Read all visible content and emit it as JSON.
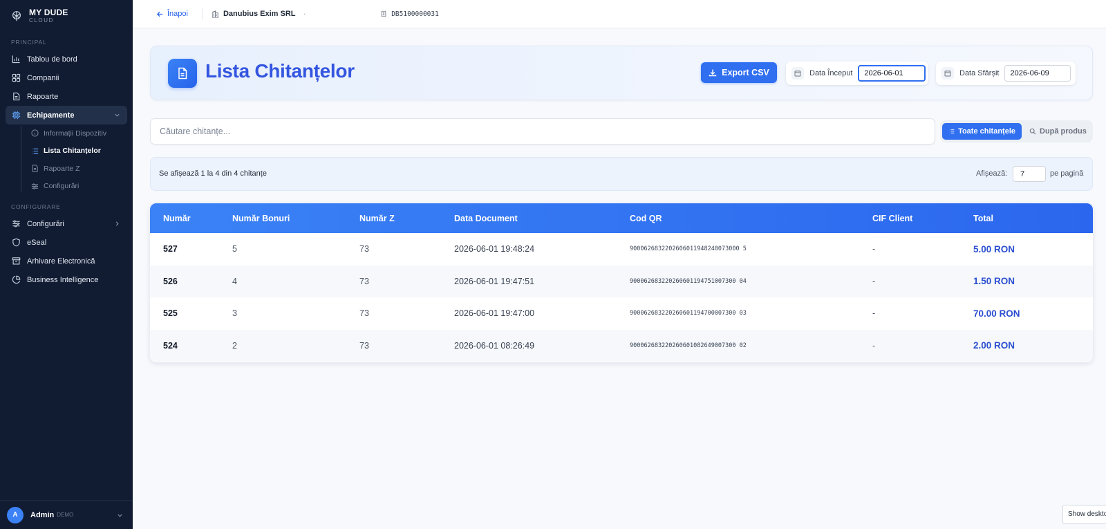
{
  "brand": {
    "title": "MY DUDE",
    "subtitle": "CLOUD"
  },
  "sidebar": {
    "sections": {
      "principal": "PRINCIPAL",
      "configurare": "CONFIGURARE"
    },
    "principal_items": [
      {
        "label": "Tablou de bord",
        "icon": "bar-chart-icon"
      },
      {
        "label": "Companii",
        "icon": "grid-icon"
      },
      {
        "label": "Rapoarte",
        "icon": "document-icon"
      },
      {
        "label": "Echipamente",
        "icon": "chip-icon",
        "active": true
      }
    ],
    "echipamente_sub": [
      {
        "label": "Informații Dispozitiv",
        "icon": "info-icon"
      },
      {
        "label": "Lista Chitanțelor",
        "icon": "list-icon",
        "active": true
      },
      {
        "label": "Rapoarte Z",
        "icon": "document-icon"
      },
      {
        "label": "Configurări",
        "icon": "sliders-icon"
      }
    ],
    "configurare_items": [
      {
        "label": "Configurări",
        "icon": "sliders-icon"
      },
      {
        "label": "eSeal",
        "icon": "shield-icon"
      },
      {
        "label": "Arhivare Electronică",
        "icon": "archive-icon"
      },
      {
        "label": "Business Intelligence",
        "icon": "pie-chart-icon"
      }
    ],
    "user": {
      "initial": "A",
      "name": "Admin",
      "role": "DEMO"
    }
  },
  "topbar": {
    "back_label": "Înapoi",
    "company": "Danubius Exim SRL",
    "company_caret": "·",
    "device_id": "DB5100000031"
  },
  "header": {
    "title": "Lista Chitanțelor",
    "export_label": "Export CSV",
    "date_start_label": "Data Început",
    "date_start_value": "2026-06-01",
    "date_end_label": "Data Sfârșit",
    "date_end_value": "2026-06-09"
  },
  "search": {
    "placeholder": "Căutare chitanțe...",
    "toggle_all": "Toate chitanțele",
    "toggle_product": "După produs"
  },
  "info": {
    "summary": "Se afișează 1 la 4 din 4 chitanțe",
    "perpage_label": "Afișează:",
    "perpage_value": "7",
    "perpage_suffix": "pe pagină"
  },
  "table": {
    "headers": [
      "Număr",
      "Număr Bonuri",
      "Număr Z",
      "Data Document",
      "Cod QR",
      "CIF Client",
      "Total"
    ],
    "rows": [
      {
        "numar": "527",
        "bonuri": "5",
        "z": "73",
        "data": "2026-06-01 19:48:24",
        "qr": "9000626832202606011948240073000 5",
        "cif": "-",
        "total": "5.00 RON"
      },
      {
        "numar": "526",
        "bonuri": "4",
        "z": "73",
        "data": "2026-06-01 19:47:51",
        "qr": "900062683220260601194751007300 04",
        "cif": "-",
        "total": "1.50 RON"
      },
      {
        "numar": "525",
        "bonuri": "3",
        "z": "73",
        "data": "2026-06-01 19:47:00",
        "qr": "900062683220260601194700007300 03",
        "cif": "-",
        "total": "70.00 RON"
      },
      {
        "numar": "524",
        "bonuri": "2",
        "z": "73",
        "data": "2026-06-01 08:26:49",
        "qr": "900062683220260601082649007300 02",
        "cif": "-",
        "total": "2.00 RON"
      }
    ]
  },
  "overlay": {
    "show_desktop": "Show desktop"
  },
  "colors": {
    "sidebar_bg": "#111c33",
    "accent": "#2f6ff0",
    "title": "#3355e0",
    "total": "#2c4fd0"
  }
}
